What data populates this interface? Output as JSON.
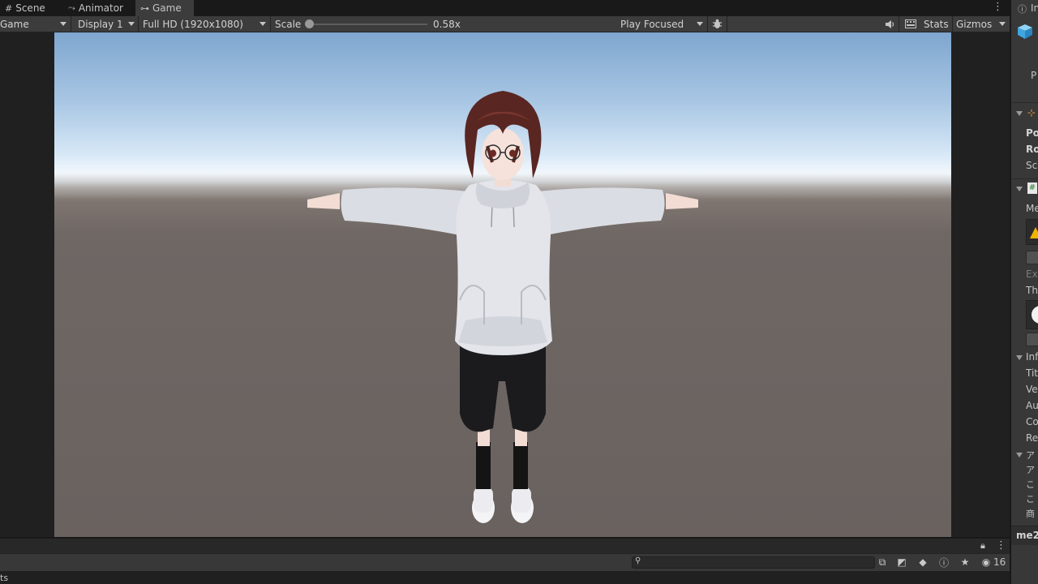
{
  "tabs": [
    {
      "label": "Scene",
      "icon": "grid-icon"
    },
    {
      "label": "Animator",
      "icon": "animator-icon"
    },
    {
      "label": "Game",
      "icon": "gamepad-icon"
    }
  ],
  "toolbar": {
    "view_mode": "Game",
    "display": "Display 1",
    "resolution": "Full HD (1920x1080)",
    "scale_label": "Scale",
    "scale_value": "0.58x",
    "scale_fraction": 0.0,
    "play_mode": "Play Focused",
    "stats": "Stats",
    "gizmos": "Gizmos"
  },
  "inspector": {
    "header": "In",
    "prefab_label": "P",
    "transform_rows": [
      "Po",
      "Ro",
      "Sc"
    ],
    "component_rows": [
      "Me",
      "Exp",
      "Th"
    ],
    "info_header": "Inf",
    "info_rows": [
      "Tit",
      "Ve",
      "Au",
      "Co",
      "Re"
    ],
    "jp_header": "ア",
    "jp_rows": [
      "ア",
      "こ",
      "こ",
      "商"
    ],
    "bottom_label": "me2"
  },
  "bottom_panel": {
    "hidden_count": "16",
    "status_text": "ts"
  },
  "colors": {
    "editor_bg": "#282828",
    "toolbar_bg": "#3c3c3c",
    "inspector_bg": "#383838",
    "warning_yellow": "#f0b400",
    "sky_top": "#7fa6cf",
    "ground": "#6a625f"
  }
}
